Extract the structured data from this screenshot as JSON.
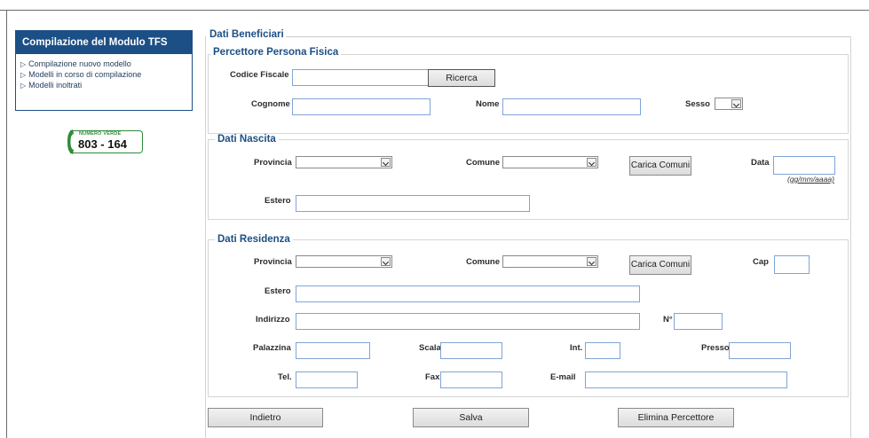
{
  "sidebar": {
    "title": "Compilazione del Modulo TFS",
    "items": [
      {
        "label": "Compilazione nuovo modello"
      },
      {
        "label": "Modelli in corso di compilazione"
      },
      {
        "label": "Modelli inoltrati"
      }
    ],
    "numero_verde": {
      "label": "NUMERO VERDE",
      "number": "803 - 164"
    }
  },
  "main": {
    "title": "Dati Beneficiari",
    "percettore": {
      "title": "Percettore Persona Fisica",
      "codice_fiscale_label": "Codice Fiscale",
      "ricerca_label": "Ricerca",
      "cognome_label": "Cognome",
      "nome_label": "Nome",
      "sesso_label": "Sesso"
    },
    "nascita": {
      "title": "Dati Nascita",
      "provincia_label": "Provincia",
      "comune_label": "Comune",
      "carica_label": "Carica Comuni",
      "data_label": "Data",
      "data_hint": "(gg/mm/aaaa)",
      "estero_label": "Estero"
    },
    "residenza": {
      "title": "Dati Residenza",
      "provincia_label": "Provincia",
      "comune_label": "Comune",
      "carica_label": "Carica Comuni",
      "cap_label": "Cap",
      "estero_label": "Estero",
      "indirizzo_label": "Indirizzo",
      "numero_label": "N°",
      "palazzina_label": "Palazzina",
      "scala_label": "Scala",
      "int_label": "Int.",
      "presso_label": "Presso",
      "tel_label": "Tel.",
      "fax_label": "Fax",
      "email_label": "E-mail"
    },
    "buttons": {
      "indietro": "Indietro",
      "salva": "Salva",
      "elimina": "Elimina Percettore"
    }
  }
}
